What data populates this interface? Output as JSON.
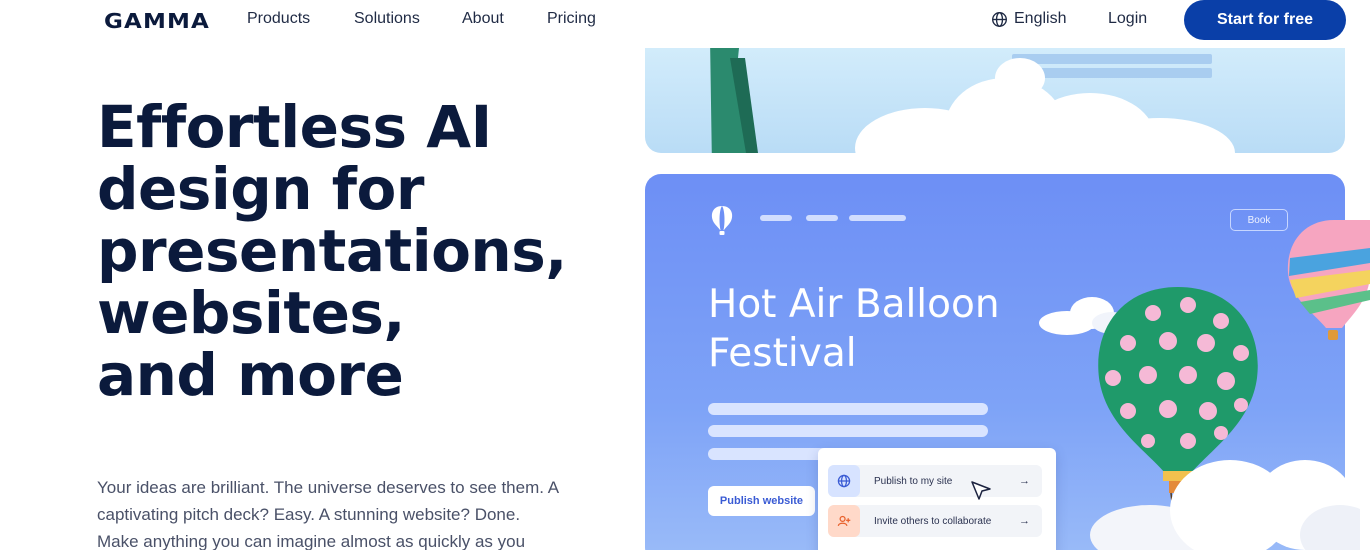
{
  "nav": {
    "logo": "GAMMA",
    "links": [
      "Products",
      "Solutions",
      "About",
      "Pricing"
    ],
    "language": "English",
    "login": "Login",
    "cta": "Start for free"
  },
  "hero": {
    "headline_lines": [
      "Effortless AI",
      "design for",
      "presentations,",
      "websites,",
      "and more"
    ],
    "subtext_lines": [
      "Your ideas are brilliant. The universe deserves to see them. A",
      "captivating pitch deck? Easy. A stunning website? Done.",
      "Make anything you can imagine almost as quickly as you"
    ]
  },
  "preview": {
    "book_label": "Book",
    "title_lines": [
      "Hot Air Balloon",
      "Festival"
    ],
    "publish_button": "Publish website",
    "popup": {
      "items": [
        {
          "label": "Publish to my site",
          "icon": "globe-icon",
          "arrow": "→"
        },
        {
          "label": "Invite others to collaborate",
          "icon": "add-user-icon",
          "arrow": "→"
        }
      ]
    }
  },
  "colors": {
    "brand_dark": "#0b1a3c",
    "cta_blue": "#0a3fa8",
    "preview_blue": "#6d8ff5"
  }
}
